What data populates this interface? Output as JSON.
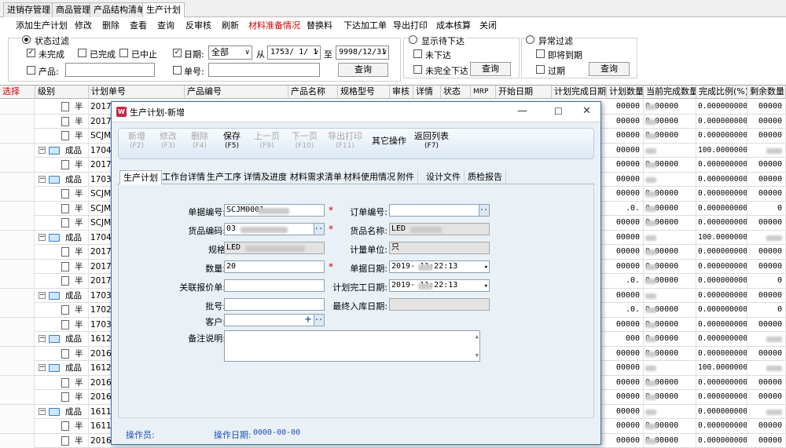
{
  "top_tabs": [
    "进销存管理",
    "商品管理",
    "产品结构清单",
    "生产计划"
  ],
  "toolbar": [
    "添加生产计划",
    "修改",
    "删除",
    "查看",
    "查询",
    "反审核",
    "刷新",
    "材料准备情况",
    "替换料",
    "下达加工单",
    "导出打印",
    "成本核算",
    "关闭"
  ],
  "filters": {
    "status_title": "状态过滤",
    "unfinished": "未完成",
    "finished": "已完成",
    "halted": "已中止",
    "date_label": "日期:",
    "date_mode": "全部",
    "from_label": "从",
    "date_from": "1753/ 1/ 1",
    "to_label": "至",
    "date_to": "9998/12/31",
    "product_label": "产品:",
    "doc_label": "单号:",
    "query": "查询",
    "show_pending_title": "显示待下达",
    "not_issued": "未下达",
    "not_fully_issued": "未完全下达",
    "query2": "查询",
    "abnormal_title": "异常过滤",
    "due_soon": "即将到期",
    "overdue": "过期",
    "query3": "查询"
  },
  "grid": {
    "headers": [
      "选择",
      "级别",
      "计划单号",
      "产品编号",
      "产品名称",
      "规格型号",
      "审核",
      "详情",
      "状态",
      "MRP",
      "开始日期",
      "计划完成日期",
      "计划数量",
      "当前完成数量",
      "完成比例(%)",
      "剩余数量"
    ],
    "rows": [
      {
        "type": "semi",
        "level": "半",
        "plan": "201703",
        "qty": "00000",
        "cur": "0.00000",
        "pct": "0.0000000000",
        "rem": "00000"
      },
      {
        "type": "semi",
        "level": "半",
        "plan": "201703",
        "qty": "00000",
        "cur": "0.00000",
        "pct": "0.0000000000",
        "rem": "00000"
      },
      {
        "type": "semi",
        "level": "半",
        "plan": "SCJM20",
        "qty": "00000",
        "cur": "0.00000",
        "pct": "0.0000000000",
        "rem": "00000"
      },
      {
        "type": "prod",
        "level": "成品",
        "plan": "170410",
        "qty": "00000",
        "cur": "",
        "pct": "100.000000000",
        "rem": ""
      },
      {
        "type": "semi",
        "level": "半",
        "plan": "201703",
        "qty": "00000",
        "cur": "0.00000",
        "pct": "0.0000000000",
        "rem": "00000"
      },
      {
        "type": "prod",
        "level": "成品",
        "plan": "170316",
        "qty": "00000",
        "cur": "",
        "pct": "0.0000000000",
        "rem": "00000"
      },
      {
        "type": "semi",
        "level": "半",
        "plan": "SCJM20",
        "qty": "00000",
        "cur": "0.00000",
        "pct": "0.0000000000",
        "rem": "00000"
      },
      {
        "type": "semi",
        "level": "半",
        "plan": "SCJM20",
        "qty": ".0.",
        "cur": "0.00000",
        "pct": "0.0000000000",
        "rem": "0"
      },
      {
        "type": "semi",
        "level": "半",
        "plan": "SCJM20",
        "qty": "00000",
        "cur": "0.00000",
        "pct": "0.0000000000",
        "rem": "00000"
      },
      {
        "type": "prod",
        "level": "成品",
        "plan": "170409",
        "qty": "00000",
        "cur": "",
        "pct": "100.000000000",
        "rem": ""
      },
      {
        "type": "semi",
        "level": "半",
        "plan": "201703",
        "qty": "00000",
        "cur": "0.00000",
        "pct": "0.0000000000",
        "rem": "00000"
      },
      {
        "type": "semi",
        "level": "半",
        "plan": "201703",
        "qty": "00000",
        "cur": "0.00000",
        "pct": "0.0000000000",
        "rem": "00000"
      },
      {
        "type": "semi",
        "level": "半",
        "plan": "201703",
        "qty": ".0.",
        "cur": "0.00000",
        "pct": "0.0000000000",
        "rem": "0"
      },
      {
        "type": "prod",
        "level": "成品",
        "plan": "170315",
        "qty": "00000",
        "cur": "",
        "pct": "0.0000000000",
        "rem": "00000"
      },
      {
        "type": "semi",
        "level": "半",
        "plan": "170206",
        "qty": ".0.",
        "cur": "0.00000",
        "pct": "0.0000000000",
        "rem": "0"
      },
      {
        "type": "semi",
        "level": "半",
        "plan": "170306",
        "qty": "00000",
        "cur": "0.00000",
        "pct": "0.0000000000",
        "rem": "00000"
      },
      {
        "type": "prod",
        "level": "成品",
        "plan": "161214",
        "qty": "000",
        "cur": "0.00000",
        "pct": "0.0000000000",
        "rem": ""
      },
      {
        "type": "semi",
        "level": "半",
        "plan": "201612",
        "qty": "00000",
        "cur": "0.00000",
        "pct": "0.0000000000",
        "rem": "00000"
      },
      {
        "type": "prod",
        "level": "成品",
        "plan": "161214",
        "qty": "00000",
        "cur": "",
        "pct": "100.000000000",
        "rem": ""
      },
      {
        "type": "semi",
        "level": "半",
        "plan": "201612",
        "qty": "00000",
        "cur": "0.00000",
        "pct": "0.0000000000",
        "rem": "00000"
      },
      {
        "type": "semi",
        "level": "半",
        "plan": "201612",
        "qty": "00000",
        "cur": "0.00000",
        "pct": "0.0000000000",
        "rem": "00000"
      },
      {
        "type": "prod",
        "level": "成品",
        "plan": "161113",
        "qty": "00000",
        "cur": "",
        "pct": "0.0000000000",
        "rem": ""
      },
      {
        "type": "semi",
        "level": "半",
        "plan": "161130",
        "qty": "00000",
        "cur": "0.00000",
        "pct": "0.0000000000",
        "rem": "00000"
      },
      {
        "type": "semi",
        "level": "半",
        "plan": "201612",
        "qty": "00000",
        "cur": "0.00000",
        "pct": "0.0000000000",
        "rem": "00000"
      }
    ]
  },
  "modal": {
    "title": "生产计划-新增",
    "toolbar": [
      {
        "label": "新增",
        "key": "(F2)",
        "disabled": true
      },
      {
        "label": "修改",
        "key": "(F3)",
        "disabled": true
      },
      {
        "label": "删除",
        "key": "(F4)",
        "disabled": true
      },
      {
        "label": "保存",
        "key": "(F5)",
        "disabled": false
      },
      {
        "label": "上一页",
        "key": "(F9)",
        "disabled": true
      },
      {
        "label": "下一页",
        "key": "(F10)",
        "disabled": true
      },
      {
        "label": "导出打印",
        "key": "(F11)",
        "disabled": true
      },
      {
        "label": "其它操作",
        "key": "",
        "disabled": false
      },
      {
        "label": "返回列表",
        "key": "(F7)",
        "disabled": false
      }
    ],
    "tabs": [
      "生产计划",
      "工作台详情",
      "生产工序",
      "详情及进度",
      "材料需求清单",
      "材料使用情况",
      "附件",
      "设计文件",
      "质检报告"
    ],
    "fields": {
      "doc_no_label": "单据编号:",
      "doc_no_value": "SCJM0001",
      "goods_code_label": "货品编码:",
      "goods_code_value": "03",
      "spec_label": "规格",
      "spec_value": "LED",
      "qty_label": "数量:",
      "qty_value": "20",
      "quote_label": "关联报价单:",
      "batch_label": "批号:",
      "customer_label": "客户:",
      "note_label": "备注说明:",
      "order_no_label": "订单编号:",
      "goods_name_label": "货品名称:",
      "goods_name_value": "LED",
      "unit_label": "计量单位:",
      "unit_value": "只",
      "doc_date_label": "单据日期:",
      "doc_date_value": "2019-    11:22:13",
      "plan_done_label": "计划完工日期:",
      "plan_done_value": "2019-    11:22:13",
      "final_in_label": "最终入库日期:"
    },
    "footer": {
      "operator_label": "操作员:",
      "op_date_label": "操作日期:",
      "op_date_value": "0000-00-00"
    }
  }
}
